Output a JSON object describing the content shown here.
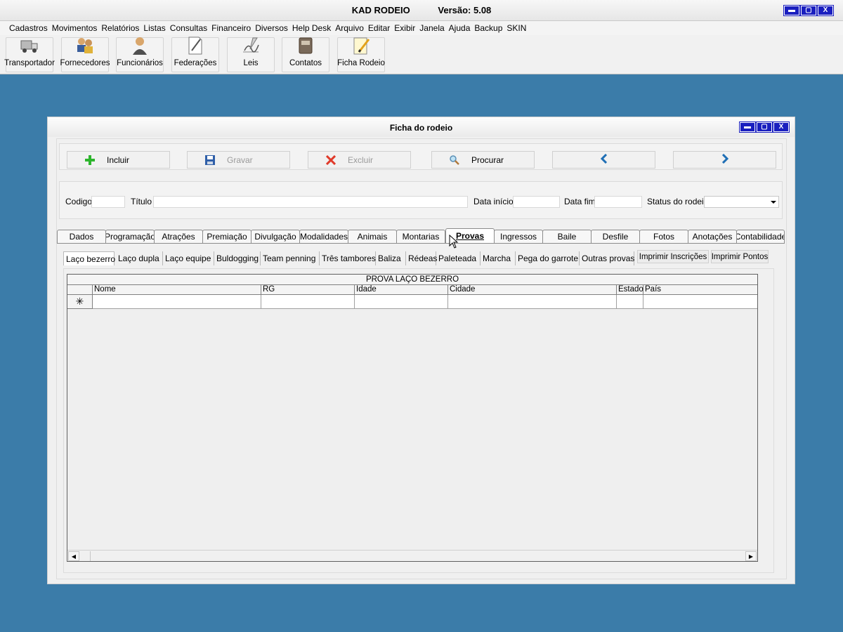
{
  "app": {
    "name": "KAD RODEIO",
    "version": "Versão: 5.08",
    "window_buttons": {
      "minimize": "▬",
      "maximize": "▢",
      "close": "X"
    }
  },
  "menu": [
    "Cadastros",
    "Movimentos",
    "Relatórios",
    "Listas",
    "Consultas",
    "Financeiro",
    "Diversos",
    "Help Desk",
    "Arquivo",
    "Editar",
    "Exibir",
    "Janela",
    "Ajuda",
    "Backup",
    "SKIN"
  ],
  "toolbar": [
    {
      "label": "Transportador",
      "icon": "truck-icon"
    },
    {
      "label": "Fornecedores",
      "icon": "suppliers-icon"
    },
    {
      "label": "Funcionários",
      "icon": "employee-icon"
    },
    {
      "label": "Federações",
      "icon": "document-pen-icon"
    },
    {
      "label": "Leis",
      "icon": "signature-icon"
    },
    {
      "label": "Contatos",
      "icon": "address-book-icon"
    },
    {
      "label": "Ficha Rodeio",
      "icon": "notepad-pencil-icon"
    }
  ],
  "child": {
    "title": "Ficha do rodeio",
    "actions": {
      "include": "Incluir",
      "save": "Gravar",
      "delete": "Excluir",
      "search": "Procurar",
      "prev": "‹",
      "next": "›"
    },
    "fields": {
      "codigo_label": "Codigo",
      "titulo_label": "Título",
      "data_inicio_label": "Data início",
      "data_fim_label": "Data fim",
      "status_label": "Status do rodeio",
      "codigo_value": "",
      "titulo_value": "",
      "data_inicio_value": "",
      "data_fim_value": "",
      "status_value": ""
    },
    "tabs": [
      "Dados",
      "Programação",
      "Atrações",
      "Premiação",
      "Divulgação",
      "Modalidades",
      "Animais",
      "Montarias",
      "Provas",
      "Ingressos",
      "Baile",
      "Desfile",
      "Fotos",
      "Anotações",
      "Contabilidade"
    ],
    "active_tab": "Provas",
    "subtabs": [
      "Laço bezerro",
      "Laço dupla",
      "Laço equipe",
      "Buldogging",
      "Team penning",
      "Três tambores",
      "Baliza",
      "Rédeas",
      "Paleteada",
      "Marcha",
      "Pega do garrote",
      "Outras provas"
    ],
    "active_subtab": "Laço bezerro",
    "print_buttons": {
      "inscricoes": "Imprimir Inscrições",
      "pontos": "Imprimir Pontos"
    },
    "grid": {
      "caption": "PROVA LAÇO BEZERRO",
      "columns": [
        "Nome",
        "RG",
        "Idade",
        "Cidade",
        "Estado",
        "País"
      ],
      "new_row_marker": "✳"
    }
  },
  "colors": {
    "desktop": "#3b7ca9",
    "window_button": "#1a1fbf",
    "add_icon": "#2db52d",
    "delete_icon": "#e03a2a",
    "nav_arrow": "#1f6fb5"
  }
}
